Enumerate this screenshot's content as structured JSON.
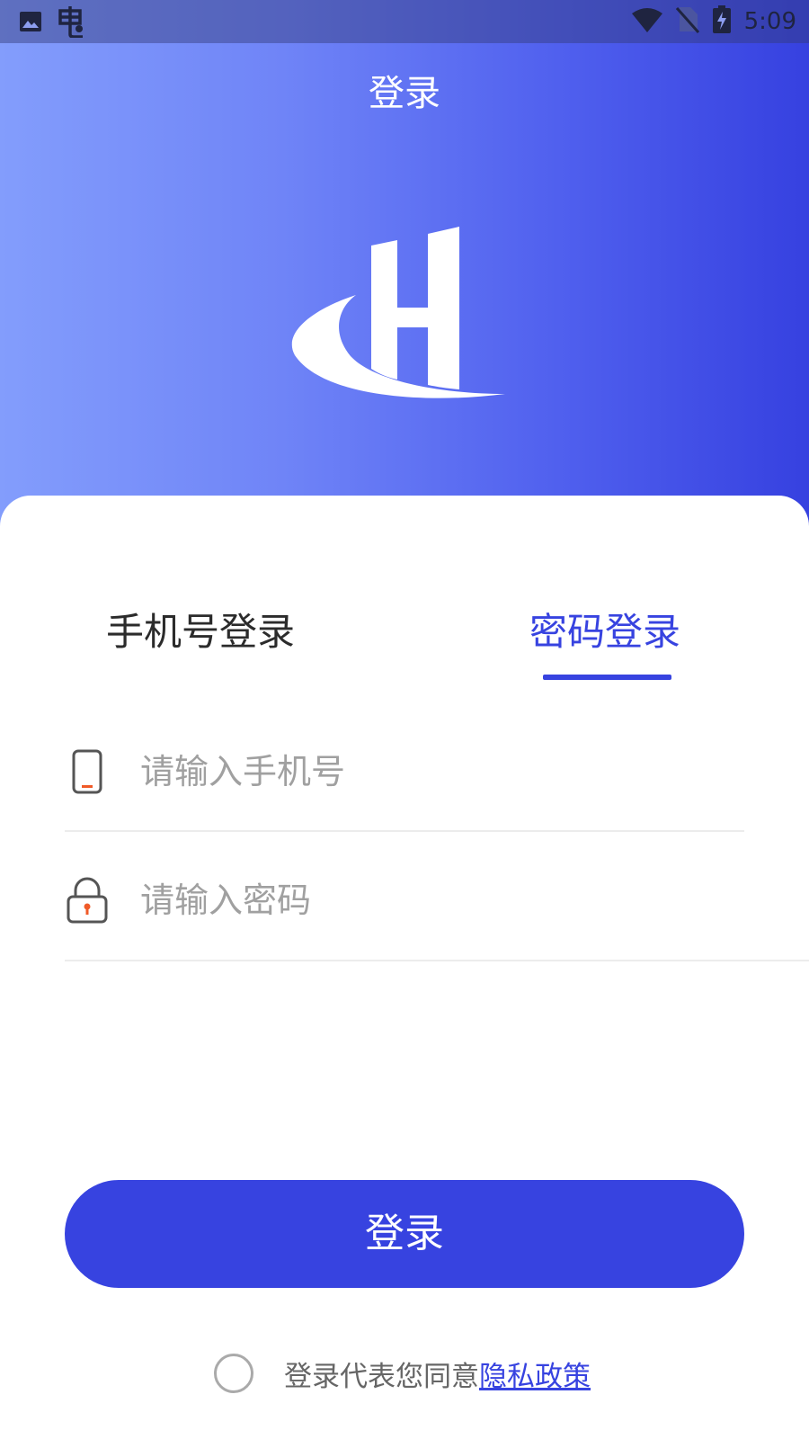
{
  "status_bar": {
    "time": "5:09",
    "icons": [
      "image-icon",
      "bug-icon",
      "wifi-icon",
      "no-sim-icon",
      "battery-charging-icon"
    ]
  },
  "header": {
    "title": "登录"
  },
  "tabs": [
    {
      "label": "手机号登录",
      "active": false
    },
    {
      "label": "密码登录",
      "active": true
    }
  ],
  "form": {
    "phone_placeholder": "请输入手机号",
    "password_placeholder": "请输入密码",
    "phone_icon": "phone-icon",
    "password_icon": "lock-icon",
    "submit_label": "登录"
  },
  "agreement": {
    "text": "登录代表您同意",
    "link": "隐私政策",
    "checked": false
  },
  "colors": {
    "accent": "#3743e0",
    "gradient_start": "#839dfc",
    "gradient_end": "#3641e0",
    "placeholder": "#a0a0a0",
    "icon_orange": "#f05a28"
  }
}
